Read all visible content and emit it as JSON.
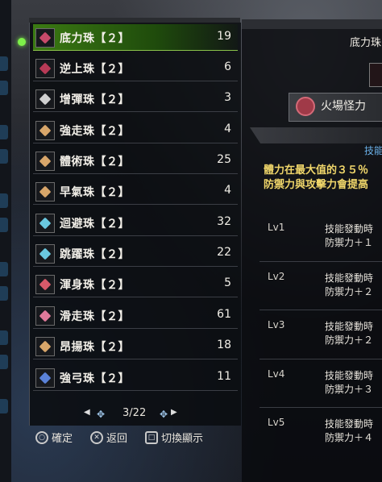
{
  "list": {
    "items": [
      {
        "name": "底力珠【２】",
        "count": "19",
        "color": "#c84a6a",
        "selected": true
      },
      {
        "name": "逆上珠【２】",
        "count": "6",
        "color": "#b83a56"
      },
      {
        "name": "增彈珠【２】",
        "count": "3",
        "color": "#d0d0d0"
      },
      {
        "name": "強走珠【２】",
        "count": "4",
        "color": "#d8a66a"
      },
      {
        "name": "體術珠【２】",
        "count": "25",
        "color": "#d8a66a"
      },
      {
        "name": "早氣珠【２】",
        "count": "4",
        "color": "#d8a66a"
      },
      {
        "name": "迴避珠【２】",
        "count": "32",
        "color": "#6ac8e0"
      },
      {
        "name": "跳躍珠【２】",
        "count": "22",
        "color": "#6ac8e0"
      },
      {
        "name": "渾身珠【２】",
        "count": "5",
        "color": "#d85a6a"
      },
      {
        "name": "滑走珠【２】",
        "count": "61",
        "color": "#e07a9a"
      },
      {
        "name": "昂揚珠【２】",
        "count": "18",
        "color": "#d8a66a"
      },
      {
        "name": "強弓珠【２】",
        "count": "11",
        "color": "#5a82d8"
      }
    ]
  },
  "pager": {
    "current": "3",
    "total": "22",
    "separator": "/"
  },
  "footer": {
    "confirm": "確定",
    "back": "返回",
    "toggle": "切換顯示"
  },
  "detail": {
    "title": "底力珠【",
    "skill_name": "火場怪力",
    "skill_tab": "技能",
    "desc_line1": "體力在最大值的３５％",
    "desc_line2": "防禦力與攻擊力會提高",
    "levels": [
      {
        "lv": "Lv1",
        "line1": "技能發動時",
        "line2": "防禦力＋１"
      },
      {
        "lv": "Lv2",
        "line1": "技能發動時",
        "line2": "防禦力＋２"
      },
      {
        "lv": "Lv3",
        "line1": "技能發動時",
        "line2": "防禦力＋２"
      },
      {
        "lv": "Lv4",
        "line1": "技能發動時",
        "line2": "防禦力＋３"
      },
      {
        "lv": "Lv5",
        "line1": "技能發動時",
        "line2": "防禦力＋４"
      }
    ]
  },
  "colors": {
    "accent": "#7ef04a",
    "selected_row": "#3b7a12",
    "desc": "#f0d66a",
    "skill_tab": "#6ab0e8"
  },
  "icons": {
    "confirm": "circle-button-icon",
    "back": "cross-button-icon",
    "toggle": "square-button-icon",
    "pager_left": "dpad-left-icon",
    "pager_right": "dpad-right-icon"
  }
}
